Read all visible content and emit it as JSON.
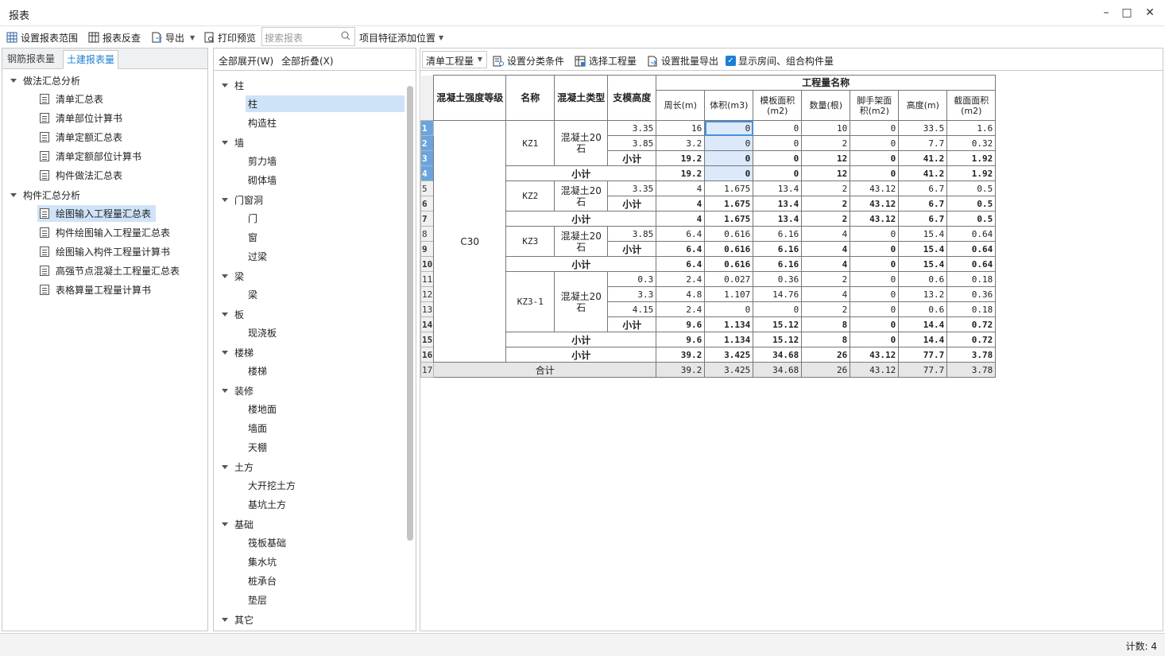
{
  "app": {
    "title": "报表"
  },
  "toolbar": {
    "set_range": "设置报表范围",
    "report_lookup": "报表反查",
    "export": "导出",
    "print_preview": "打印预览",
    "search_placeholder": "搜索报表",
    "feature_position": "项目特征添加位置"
  },
  "left_panel": {
    "tabs": [
      "钢筋报表量",
      "土建报表量"
    ],
    "active_tab": "土建报表量",
    "groups": [
      {
        "label": "做法汇总分析",
        "items": [
          "清单汇总表",
          "清单部位计算书",
          "清单定额汇总表",
          "清单定额部位计算书",
          "构件做法汇总表"
        ]
      },
      {
        "label": "构件汇总分析",
        "items": [
          "绘图输入工程量汇总表",
          "构件绘图输入工程量汇总表",
          "绘图输入构件工程量计算书",
          "高强节点混凝土工程量汇总表",
          "表格算量工程量计算书"
        ]
      }
    ],
    "selected_item": "绘图输入工程量汇总表"
  },
  "middle_panel": {
    "expand_all": "全部展开(W)",
    "collapse_all": "全部折叠(X)",
    "categories": [
      {
        "label": "柱",
        "items": [
          "柱",
          "构造柱"
        ]
      },
      {
        "label": "墙",
        "items": [
          "剪力墙",
          "砌体墙"
        ]
      },
      {
        "label": "门窗洞",
        "items": [
          "门",
          "窗",
          "过梁"
        ]
      },
      {
        "label": "梁",
        "items": [
          "梁"
        ]
      },
      {
        "label": "板",
        "items": [
          "现浇板"
        ]
      },
      {
        "label": "楼梯",
        "items": [
          "楼梯"
        ]
      },
      {
        "label": "装修",
        "items": [
          "楼地面",
          "墙面",
          "天棚"
        ]
      },
      {
        "label": "土方",
        "items": [
          "大开挖土方",
          "基坑土方"
        ]
      },
      {
        "label": "基础",
        "items": [
          "筏板基础",
          "集水坑",
          "桩承台",
          "垫层"
        ]
      },
      {
        "label": "其它",
        "items": []
      }
    ],
    "selected_item": "柱"
  },
  "right_panel": {
    "quantity_type": "清单工程量",
    "set_category": "设置分类条件",
    "select_quantity": "选择工程量",
    "batch_export": "设置批量导出",
    "show_rooms_checked": true,
    "show_rooms": "显示房间、组合构件量"
  },
  "grid": {
    "headers": {
      "grade": "混凝土强度等级",
      "name": "名称",
      "type": "混凝土类型",
      "height": "支模高度",
      "group": "工程量名称",
      "cols": [
        "周长(m)",
        "体积(m3)",
        "模板面积(m2)",
        "数量(根)",
        "脚手架面积(m2)",
        "高度(m)",
        "截面面积(m2)"
      ]
    },
    "row_numbers": [
      "1",
      "2",
      "3",
      "4",
      "5",
      "6",
      "7",
      "8",
      "9",
      "10",
      "11",
      "12",
      "13",
      "14",
      "15",
      "16",
      "17"
    ],
    "grade": "C30",
    "type_label": "混凝土20石",
    "subtotal_label": "小计",
    "total_label": "合计",
    "components": [
      {
        "name": "KZ1",
        "rows": [
          {
            "h": "3.35",
            "v": [
              "16",
              "0",
              "0",
              "10",
              "0",
              "33.5",
              "1.6"
            ]
          },
          {
            "h": "3.85",
            "v": [
              "3.2",
              "0",
              "0",
              "2",
              "0",
              "7.7",
              "0.32"
            ]
          }
        ],
        "type_subtotal": [
          "19.2",
          "0",
          "0",
          "12",
          "0",
          "41.2",
          "1.92"
        ],
        "subtotal": [
          "19.2",
          "0",
          "0",
          "12",
          "0",
          "41.2",
          "1.92"
        ]
      },
      {
        "name": "KZ2",
        "rows": [
          {
            "h": "3.35",
            "v": [
              "4",
              "1.675",
              "13.4",
              "2",
              "43.12",
              "6.7",
              "0.5"
            ]
          }
        ],
        "type_subtotal": [
          "4",
          "1.675",
          "13.4",
          "2",
          "43.12",
          "6.7",
          "0.5"
        ],
        "subtotal": [
          "4",
          "1.675",
          "13.4",
          "2",
          "43.12",
          "6.7",
          "0.5"
        ]
      },
      {
        "name": "KZ3",
        "rows": [
          {
            "h": "3.85",
            "v": [
              "6.4",
              "0.616",
              "6.16",
              "4",
              "0",
              "15.4",
              "0.64"
            ]
          }
        ],
        "type_subtotal": [
          "6.4",
          "0.616",
          "6.16",
          "4",
          "0",
          "15.4",
          "0.64"
        ],
        "subtotal": [
          "6.4",
          "0.616",
          "6.16",
          "4",
          "0",
          "15.4",
          "0.64"
        ]
      },
      {
        "name": "KZ3-1",
        "rows": [
          {
            "h": "0.3",
            "v": [
              "2.4",
              "0.027",
              "0.36",
              "2",
              "0",
              "0.6",
              "0.18"
            ]
          },
          {
            "h": "3.3",
            "v": [
              "4.8",
              "1.107",
              "14.76",
              "4",
              "0",
              "13.2",
              "0.36"
            ]
          },
          {
            "h": "4.15",
            "v": [
              "2.4",
              "0",
              "0",
              "2",
              "0",
              "0.6",
              "0.18"
            ]
          }
        ],
        "type_subtotal": [
          "9.6",
          "1.134",
          "15.12",
          "8",
          "0",
          "14.4",
          "0.72"
        ],
        "subtotal": [
          "9.6",
          "1.134",
          "15.12",
          "8",
          "0",
          "14.4",
          "0.72"
        ]
      }
    ],
    "grade_subtotal": [
      "39.2",
      "3.425",
      "34.68",
      "26",
      "43.12",
      "77.7",
      "3.78"
    ],
    "grand_total": [
      "39.2",
      "3.425",
      "34.68",
      "26",
      "43.12",
      "77.7",
      "3.78"
    ]
  },
  "status": {
    "count_label": "计数: 4"
  }
}
